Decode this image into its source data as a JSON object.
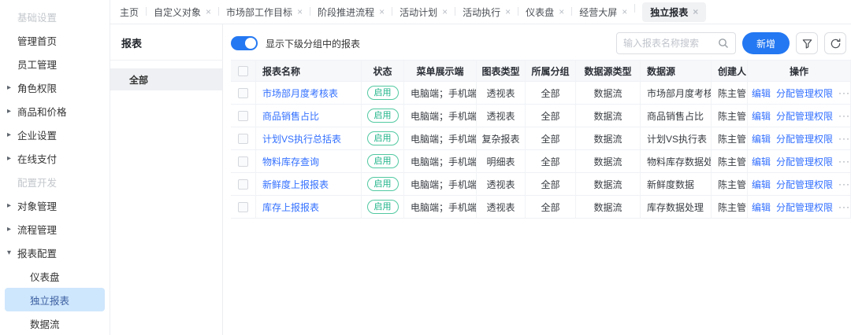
{
  "colors": {
    "primary": "#2478f2",
    "link": "#3370ff",
    "green": "#1db387",
    "green_border": "#52c9a2",
    "sel_bg": "#cfe7fd",
    "sel_text": "#3b5fa0"
  },
  "sidebar": {
    "items": [
      {
        "label": "基础设置",
        "type": "section"
      },
      {
        "label": "管理首页",
        "type": "item"
      },
      {
        "label": "员工管理",
        "type": "item"
      },
      {
        "label": "角色权限",
        "type": "collapsed"
      },
      {
        "label": "商品和价格",
        "type": "collapsed"
      },
      {
        "label": "企业设置",
        "type": "collapsed"
      },
      {
        "label": "在线支付",
        "type": "collapsed"
      },
      {
        "label": "配置开发",
        "type": "section"
      },
      {
        "label": "对象管理",
        "type": "collapsed"
      },
      {
        "label": "流程管理",
        "type": "collapsed"
      },
      {
        "label": "报表配置",
        "type": "expanded"
      },
      {
        "label": "仪表盘",
        "type": "sub"
      },
      {
        "label": "独立报表",
        "type": "sub",
        "selected": true
      },
      {
        "label": "数据流",
        "type": "sub"
      }
    ]
  },
  "tabs": [
    {
      "label": "主页",
      "closable": false,
      "active": false
    },
    {
      "label": "自定义对象",
      "closable": true,
      "active": false
    },
    {
      "label": "市场部工作目标",
      "closable": true,
      "active": false
    },
    {
      "label": "阶段推进流程",
      "closable": true,
      "active": false
    },
    {
      "label": "活动计划",
      "closable": true,
      "active": false
    },
    {
      "label": "活动执行",
      "closable": true,
      "active": false
    },
    {
      "label": "仪表盘",
      "closable": true,
      "active": false
    },
    {
      "label": "经营大屏",
      "closable": true,
      "active": false
    },
    {
      "label": "独立报表",
      "closable": true,
      "active": true
    }
  ],
  "group_panel": {
    "title": "报表",
    "items": [
      {
        "label": "全部",
        "selected": true
      }
    ]
  },
  "toolbar": {
    "toggle_label": "显示下级分组中的报表",
    "toggle_on": true,
    "search_placeholder": "输入报表名称搜索",
    "search_value": "",
    "add_label": "新增"
  },
  "table": {
    "columns": [
      "报表名称",
      "状态",
      "菜单展示端",
      "图表类型",
      "所属分组",
      "数据源类型",
      "数据源",
      "创建人",
      "操作"
    ],
    "row_actions": {
      "edit": "编辑",
      "assign": "分配管理权限",
      "more": "···"
    },
    "rows": [
      {
        "name": "市场部月度考核表",
        "status": "启用",
        "menu": "电脑端；手机端...",
        "chart_type": "透视表",
        "group": "全部",
        "ds_type": "数据流",
        "ds": "市场部月度考核",
        "creator": "陈主管"
      },
      {
        "name": "商品销售占比",
        "status": "启用",
        "menu": "电脑端；手机端...",
        "chart_type": "透视表",
        "group": "全部",
        "ds_type": "数据流",
        "ds": "商品销售占比",
        "creator": "陈主管"
      },
      {
        "name": "计划VS执行总括表",
        "status": "启用",
        "menu": "电脑端；手机端...",
        "chart_type": "复杂报表",
        "group": "全部",
        "ds_type": "数据流",
        "ds": "计划VS执行表",
        "creator": "陈主管"
      },
      {
        "name": "物料库存查询",
        "status": "启用",
        "menu": "电脑端；手机端...",
        "chart_type": "明细表",
        "group": "全部",
        "ds_type": "数据流",
        "ds": "物料库存数据处...",
        "creator": "陈主管"
      },
      {
        "name": "新鲜度上报报表",
        "status": "启用",
        "menu": "电脑端；手机端...",
        "chart_type": "透视表",
        "group": "全部",
        "ds_type": "数据流",
        "ds": "新鲜度数据",
        "creator": "陈主管"
      },
      {
        "name": "库存上报报表",
        "status": "启用",
        "menu": "电脑端；手机端...",
        "chart_type": "透视表",
        "group": "全部",
        "ds_type": "数据流",
        "ds": "库存数据处理",
        "creator": "陈主管"
      }
    ]
  }
}
